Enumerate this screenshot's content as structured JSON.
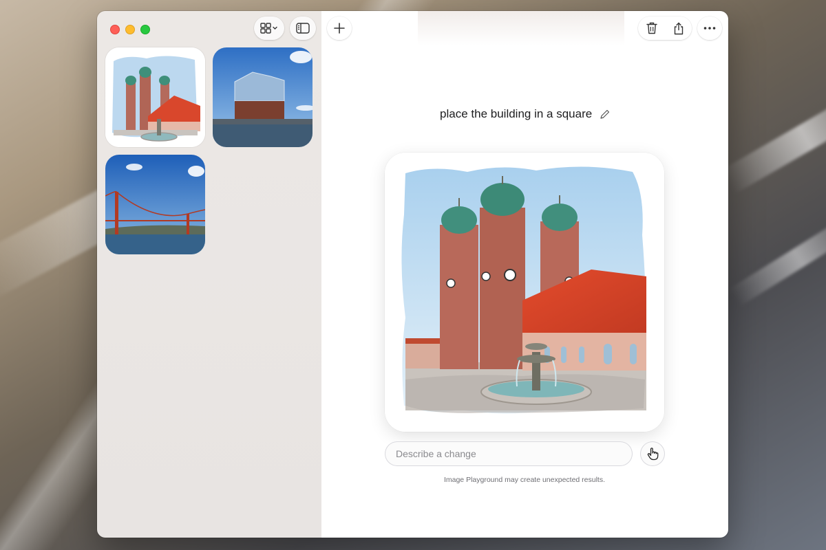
{
  "window": {
    "traffic_lights": [
      "close",
      "minimize",
      "zoom"
    ]
  },
  "toolbar": {
    "view_menu_icon": "grid-icon",
    "sidebar_toggle_icon": "sidebar-icon",
    "new_icon": "plus-icon",
    "delete_icon": "trash-icon",
    "share_icon": "share-icon",
    "more_icon": "ellipsis-icon"
  },
  "gallery": {
    "items": [
      {
        "subject": "cathedral with fountain",
        "selected": true
      },
      {
        "subject": "concert hall on harbor",
        "selected": false
      },
      {
        "subject": "suspension bridge",
        "selected": false
      }
    ]
  },
  "main": {
    "prompt_title": "place the building in a square",
    "input_placeholder": "Describe a change",
    "disclaimer": "Image Playground may create unexpected results."
  },
  "colors": {
    "sidebar_bg": "#ece8e5",
    "main_bg": "#ffffff",
    "traffic_red": "#fe5f57",
    "traffic_yellow": "#febc2e",
    "traffic_green": "#28c840"
  }
}
